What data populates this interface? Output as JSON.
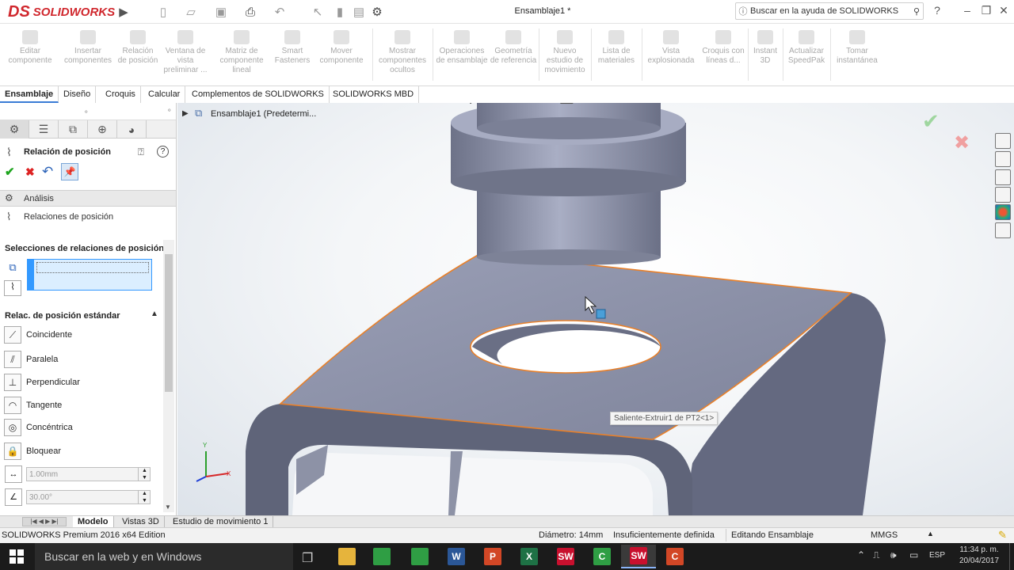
{
  "app": {
    "logo_ds": "DS",
    "logo_text": "SOLIDWORKS",
    "document_title": "Ensamblaje1 *",
    "help_search": "Buscar en la ayuda de SOLIDWORKS",
    "help_button": "?"
  },
  "ribbon": {
    "buttons": [
      "Editar componente",
      "Insertar componentes",
      "Relación de posición",
      "Ventana de vista preliminar ...",
      "Matriz de componente lineal",
      "Smart Fasteners",
      "Mover componente",
      "Mostrar componentes ocultos",
      "Operaciones de ensamblaje",
      "Geometría de referencia",
      "Nuevo estudio de movimiento",
      "Lista de materiales",
      "Vista explosionada",
      "Croquis con líneas d...",
      "Instant 3D",
      "Actualizar SpeedPak",
      "Tomar instantánea"
    ]
  },
  "tabs": [
    "Ensamblaje",
    "Diseño",
    "Croquis",
    "Calcular",
    "Complementos de SOLIDWORKS",
    "SOLIDWORKS MBD"
  ],
  "tree": {
    "root": "Ensamblaje1  (Predetermi..."
  },
  "property_manager": {
    "title": "Relación de posición",
    "section_analysis": "Análisis",
    "mates_link": "Relaciones de posición",
    "selections_header": "Selecciones de relaciones de posición",
    "standard_header": "Relac. de posición estándar",
    "mates": [
      "Coincidente",
      "Paralela",
      "Perpendicular",
      "Tangente",
      "Concéntrica",
      "Bloquear"
    ],
    "distance_value": "1.00mm",
    "angle_value": "30.00°"
  },
  "viewport": {
    "tooltip": "Saliente-Extruir1 de PT2<1>",
    "colors": {
      "part_face": "#8d92a8",
      "part_side": "#6c7186",
      "edge_highlight": "#e8802a"
    }
  },
  "bottom_tabs": [
    "Modelo",
    "Vistas 3D",
    "Estudio de movimiento 1"
  ],
  "status": {
    "product": "SOLIDWORKS Premium 2016 x64 Edition",
    "diameter": "Diámetro: 14mm",
    "definition": "Insuficientemente definida",
    "mode": "Editando Ensamblaje",
    "units": "MMGS"
  },
  "taskbar": {
    "search_text": "Buscar en la web y en Windows",
    "language": "ESP",
    "time": "11:34 p. m.",
    "date": "20/04/2017",
    "apps": [
      {
        "icon": "folder-icon",
        "color": "#e6b43c",
        "label": ""
      },
      {
        "icon": "chart-icon",
        "color": "#2f9e44",
        "label": ""
      },
      {
        "icon": "chart-icon",
        "color": "#2f9e44",
        "label": ""
      },
      {
        "icon": "word-icon",
        "color": "#2b5797",
        "label": "W"
      },
      {
        "icon": "powerpoint-icon",
        "color": "#d24726",
        "label": "P"
      },
      {
        "icon": "excel-icon",
        "color": "#1e7145",
        "label": "X"
      },
      {
        "icon": "solidworks-icon",
        "color": "#c8102e",
        "label": "SW"
      },
      {
        "icon": "camtasia-icon",
        "color": "#2f9e44",
        "label": "C"
      },
      {
        "icon": "solidworks-icon",
        "color": "#c8102e",
        "label": "SW"
      },
      {
        "icon": "camtasia-icon",
        "color": "#d24726",
        "label": "C"
      }
    ]
  }
}
